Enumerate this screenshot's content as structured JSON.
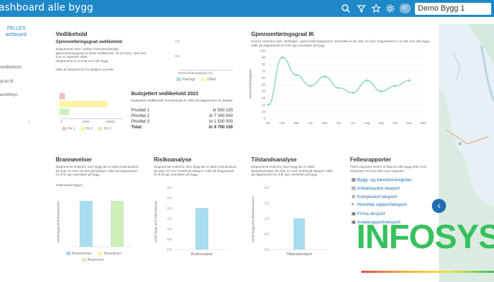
{
  "header": {
    "title": "ashboard alle bygg",
    "project": "Demo Bygg 1",
    "avatar_initials": "BT",
    "icons": [
      "search-icon",
      "filter-icon",
      "star-icon",
      "gear-icon"
    ]
  },
  "sidebar": {
    "section": "FELLES",
    "active": "ashboard",
    "items": [
      "vedlikehold",
      "grad IK",
      "annitilsyn"
    ]
  },
  "vedlikehold": {
    "title": "Vedlikehold",
    "subtitle": "Gjennomføringsgrad vedlikehold",
    "desc": [
      "Diagrammet viser i hvilken forbruket planlagt",
      "gjennomføringsgrad av årets vedlikehold i 18.10.2023, samt hva",
      "som er registrert utført.",
      "Diagrammet er et snitt over alle bygg."
    ],
    "note": "Klikk på diagrammet for detaljert oversikt.",
    "yticks": [
      "1.0",
      "0.5"
    ],
    "xlabel": "Gjennomføringsgrad (%)",
    "legend": [
      {
        "label": "Planlagt",
        "color": "#a8ddf0"
      },
      {
        "label": "Utført",
        "color": "#fff3a8"
      }
    ],
    "hbar_legend": [
      {
        "label": "Pri 1",
        "color": "#f5c0c0"
      },
      {
        "label": "Pri 2",
        "color": "#fff3a8"
      },
      {
        "label": "Pri 3",
        "color": "#cdf0b8"
      }
    ],
    "hbar_xticks": [
      "0",
      "5000",
      "10000"
    ]
  },
  "budsjett": {
    "title": "Budsjettert vedlikehold 2023",
    "desc": "Budsjettert vedlikehold inneværende år. Klikk på diagrammet for detaljer.",
    "rows": [
      {
        "label": "Prioritet 1",
        "value": "kr 900 100"
      },
      {
        "label": "Prioritet 2",
        "value": "kr 7 300 000"
      },
      {
        "label": "Prioritet 3",
        "value": "kr 1 500 000"
      }
    ],
    "total_label": "Total:",
    "total_value": "kr 9 700 100"
  },
  "gjennomforing": {
    "title": "Gjennomføringsgrad IK",
    "desc": "Kurven nedenfor viser utviklingen i gjennomføringsgrad IK. Intervallet er de siste 12 mnd. Diagrammet er et snitt over alle bygg. Klikk på diagrammet for å få opp oversikten på bygg.",
    "ylabel": "Gjennomføringsgrad"
  },
  "brannovelser": {
    "title": "Brannøvelser",
    "desc": "Diagrammet nedenfor viser bygg der er utført brannøvelser de siste 12 mnd. for den på kategori. Klikk på diagrammet for å få opp oversikten på bygg.",
    "note": "Totalt antall bygg:3",
    "ylabel": "Antall bygg med Brannøvelse",
    "legend": [
      {
        "label": "Brannøvelse",
        "color": "#a8ddf0"
      },
      {
        "label": "Branntilsyn",
        "color": "#fff3a8"
      },
      {
        "label": "Brannvern",
        "color": "#cdf0b8"
      }
    ]
  },
  "risiko": {
    "title": "Risikoanalyse",
    "desc": "Diagrammet nedenfor viser bygg der er utført risikoanalyse de siste 12 mnd. fordelt på kategori. Klikk på diagrammet for å få opp oversikten på bygg.",
    "ylabel": "Antall bygg med risikoanalyse",
    "yticks": [
      "3.0",
      "2.5",
      "2.0",
      "1.5",
      "1.0",
      "0.5",
      "0.0"
    ],
    "xlabel": "Risikoanalyse"
  },
  "tilstand": {
    "title": "Tilstandsanalyse",
    "desc": "Diagrammet nedenfor viser bygg der er utført tilstandsanalyse de siste 12 mnd. fordelt på kategori. Klikk på diagrammet for å få opp oversikten på bygg.",
    "ylabel": "Antall bygg med tilstandsanalyse",
    "yticks": [
      "2.0",
      "1.5",
      "1.0",
      "0.5",
      "0.0"
    ],
    "xlabel": "Tilstandsanalyse"
  },
  "rapporter": {
    "title": "Fellesrapporter",
    "desc": "Felles rapporter henter ut data for alle bygg enten som eksportere til excel eller som rapporter.",
    "links": [
      {
        "icon": "building-icon",
        "label": "Bygg- og eiendomsregister"
      },
      {
        "icon": "clipboard-icon",
        "label": "Arbeidsordre eksport"
      },
      {
        "icon": "component-icon",
        "label": "Komponent eksport"
      },
      {
        "icon": "list-icon",
        "label": "Historikk rapport/eksport"
      },
      {
        "icon": "document-icon",
        "label": "Firma eksport"
      },
      {
        "icon": "document-icon",
        "label": "Avtalerapport/eksport"
      }
    ]
  },
  "brand": {
    "logo_text": "INFOSYS",
    "logo_color": "#37c15d",
    "accent": "#1f88c8"
  },
  "chart_data": [
    {
      "type": "line",
      "title": "Gjennomføringsgrad IK",
      "ylabel": "Gjennomføringsgrad",
      "x": [
        "Jan",
        "Feb",
        "Mar",
        "Apr",
        "Mai",
        "Jun",
        "Jul",
        "Aug",
        "Sep",
        "Okt",
        "Nov",
        "Des"
      ],
      "series": [
        {
          "values": [
            20,
            90,
            64,
            48,
            62,
            45,
            38,
            56,
            40,
            48,
            56
          ]
        }
      ],
      "ylim": [
        0,
        100
      ],
      "yticks": [
        0,
        10,
        20,
        30,
        40,
        50,
        60,
        70,
        80,
        90,
        100
      ],
      "color": "#8fd6c6"
    },
    {
      "type": "bar",
      "title": "Brannøvelser",
      "categories": [
        "Brannøvelse",
        "Branntilsyn"
      ],
      "values": [
        1.0,
        1.0
      ],
      "ylim": [
        0,
        1.2
      ],
      "colors": [
        "#a8ddf0",
        "#cdf0b8"
      ]
    },
    {
      "type": "bar",
      "title": "Risikoanalyse",
      "categories": [
        "Risikoanalyse"
      ],
      "values": [
        2
      ],
      "ylim": [
        0,
        3
      ],
      "colors": [
        "#a8ddf0"
      ]
    },
    {
      "type": "bar",
      "title": "Tilstandsanalyse",
      "categories": [
        "Tilstandsanalyse"
      ],
      "values": [
        1
      ],
      "ylim": [
        0,
        2
      ],
      "colors": [
        "#a8ddf0"
      ]
    }
  ]
}
